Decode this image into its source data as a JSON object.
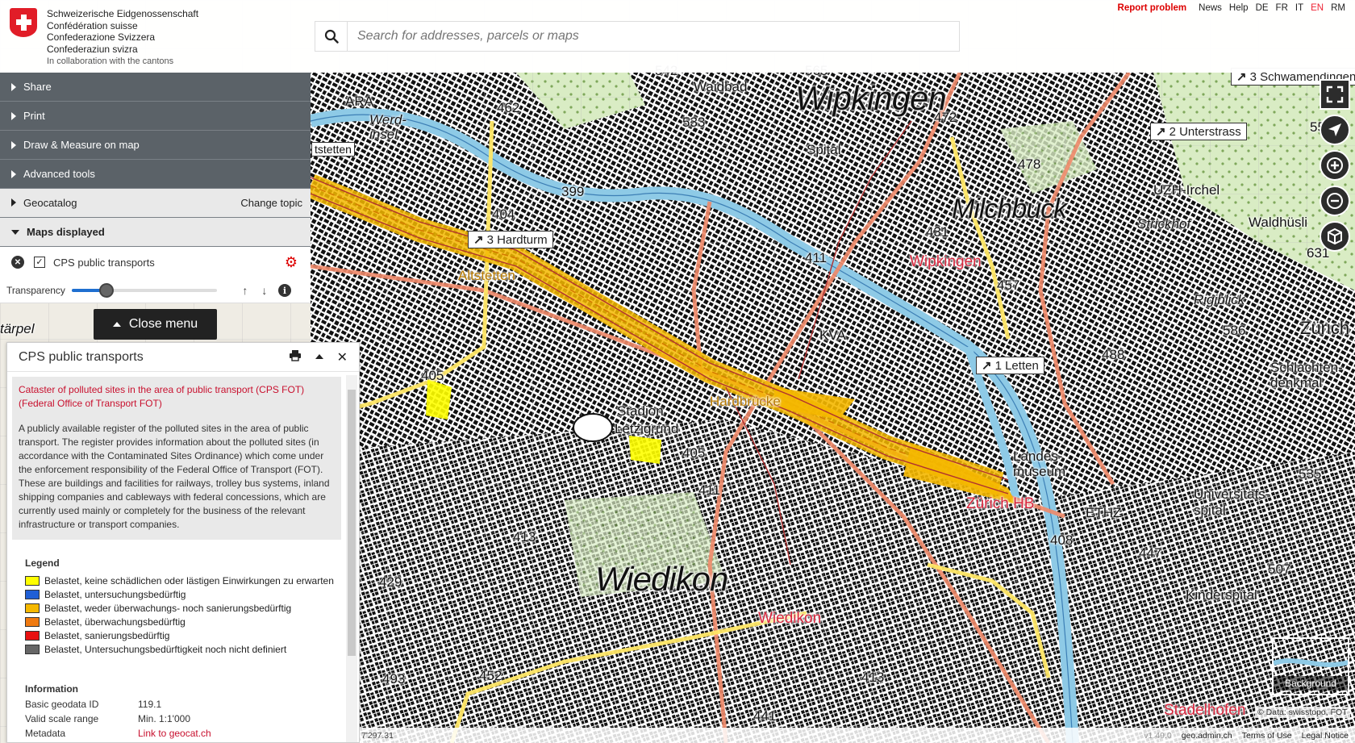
{
  "header": {
    "logo_lines": [
      "Schweizerische Eidgenossenschaft",
      "Confédération suisse",
      "Confederazione Svizzera",
      "Confederaziun svizra"
    ],
    "collab": "In collaboration with the cantons",
    "search_placeholder": "Search for addresses, parcels or maps",
    "links": {
      "report": "Report problem",
      "news": "News",
      "help": "Help"
    },
    "languages": [
      "DE",
      "FR",
      "IT",
      "EN",
      "RM"
    ],
    "active_language": "EN"
  },
  "menu": {
    "share": "Share",
    "print": "Print",
    "draw": "Draw & Measure on map",
    "advanced": "Advanced tools",
    "geocatalog": "Geocatalog",
    "change_topic": "Change topic",
    "maps_displayed": "Maps displayed",
    "layer_name": "CPS public transports",
    "transparency_label": "Transparency",
    "transparency_value": 0.24,
    "close_menu": "Close menu"
  },
  "popup": {
    "title": "CPS public transports",
    "desc_title": "Cataster of polluted sites in the area of public transport (CPS FOT) (Federal Office of Transport FOT)",
    "desc_text": "A publicly available register of the polluted sites in the area of public transport. The register provides information about the polluted sites (in accordance with the Contaminated Sites Ordinance) which come under the enforcement responsibility of the Federal Office of Transport (FOT). These are buildings and facilities for railways, trolley bus systems, inland shipping companies and cableways with federal concessions, which are currently used mainly or completely for the business of the relevant infrastructure or transport companies.",
    "legend_title": "Legend",
    "legend": [
      {
        "label": "Belastet, keine schädlichen oder lästigen Einwirkungen zu erwarten",
        "color": "#ffff00"
      },
      {
        "label": "Belastet, untersuchungsbedürftig",
        "color": "#1f5fd6"
      },
      {
        "label": "Belastet, weder überwachungs- noch sanierungsbedürftig",
        "color": "#f5b800"
      },
      {
        "label": "Belastet, überwachungsbedürftig",
        "color": "#f07a10"
      },
      {
        "label": "Belastet, sanierungsbedürftig",
        "color": "#e81010"
      },
      {
        "label": "Belastet, Untersuchungsbedürftigkeit noch nicht definiert",
        "color": "#666666"
      }
    ],
    "info_title": "Information",
    "info": [
      {
        "key": "Basic geodata ID",
        "value": "119.1"
      },
      {
        "key": "Valid scale range",
        "value": "Min. 1:1'000"
      },
      {
        "key": "Metadata",
        "value": "Link to geocat.ch"
      }
    ]
  },
  "map": {
    "places_large": [
      "Wipkingen",
      "Milchbuck",
      "Wiedikon"
    ],
    "places": [
      "Waidbad",
      "Werd-insel",
      "ARA",
      "Letzigrund",
      "Stadion",
      "Landes-museum",
      "Universitäts-spital",
      "Kinderspital",
      "UZH-Irchel",
      "Strickhof",
      "Waldhüsli",
      "Rigiblick",
      "Zürich",
      "Schlachten-denkmal",
      "ETHZ",
      "KVA",
      "Spital",
      "Altstetten",
      "tärpel",
      "tstetten"
    ],
    "red_labels": [
      "Wipkingen",
      "Zürich HB",
      "Wiedikon",
      "Stadelhofen",
      "Hardbrücke"
    ],
    "stops": [
      {
        "num": "3",
        "name": "Hardturm"
      },
      {
        "num": "1",
        "name": "Letten"
      },
      {
        "num": "2",
        "name": "Unterstrass"
      },
      {
        "num": "3",
        "name": "Schwamendingen"
      }
    ],
    "heights": [
      "462",
      "533",
      "472",
      "478",
      "550",
      "399",
      "404",
      "411",
      "431",
      "457",
      "488",
      "586",
      "631",
      "405",
      "405",
      "411",
      "413",
      "429",
      "493",
      "452",
      "408",
      "447",
      "507",
      "535",
      "413",
      "441",
      "542",
      "565"
    ],
    "background_label": "Background",
    "data_credit": "© Data: swisstopo, FOT"
  },
  "footer": {
    "coords": "7'297.31",
    "version": "v1.49.0",
    "site": "geo.admin.ch",
    "terms": "Terms of Use",
    "legal": "Legal Notice"
  },
  "colors": {
    "accent_red": "#d00000",
    "menu_dark": "#5b6268",
    "layer_yellow": "#f5b800",
    "river": "#8ecae6"
  }
}
